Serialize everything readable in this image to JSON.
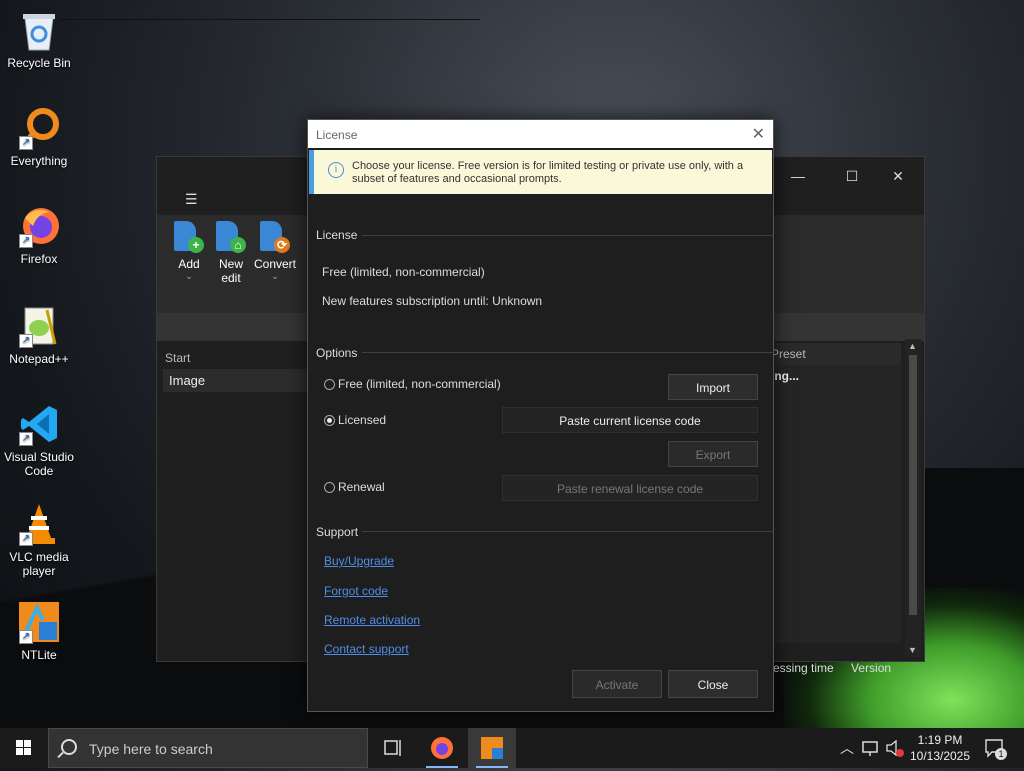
{
  "desktop": {
    "icons": [
      {
        "label": "Recycle Bin"
      },
      {
        "label": "Everything"
      },
      {
        "label": "Firefox"
      },
      {
        "label": "Notepad++"
      },
      {
        "label": "Visual Studio Code"
      },
      {
        "label": "VLC media player"
      },
      {
        "label": "NTLite"
      }
    ]
  },
  "app": {
    "toolbar": {
      "add": "Add",
      "new_edit": "New edit",
      "convert": "Convert"
    },
    "left_header": "Start",
    "left_row": "Image",
    "right_header": "Preset",
    "right_cell": "ing...",
    "status": {
      "processing_time": "cessing time",
      "version": "Version"
    }
  },
  "dialog": {
    "title": "License",
    "info": "Choose your license. Free version is for limited testing or private use only, with a subset of features and occasional prompts.",
    "license_section": "License",
    "license_type": "Free (limited, non-commercial)",
    "subscription": "New features subscription until: Unknown",
    "options_section": "Options",
    "opt_free": "Free (limited, non-commercial)",
    "opt_licensed": "Licensed",
    "opt_renewal": "Renewal",
    "import_btn": "Import",
    "paste_current_btn": "Paste current license code",
    "export_btn": "Export",
    "paste_renewal_btn": "Paste renewal license code",
    "support_section": "Support",
    "links": {
      "buy": "Buy/Upgrade",
      "forgot": "Forgot code",
      "remote": "Remote activation",
      "contact": "Contact support"
    },
    "activate_btn": "Activate",
    "close_btn": "Close",
    "selected_option": "Licensed"
  },
  "taskbar": {
    "search_placeholder": "Type here to search",
    "time": "1:19 PM",
    "date": "10/13/2025",
    "notification_count": "1"
  },
  "colors": {
    "accent_link": "#4f8ee8",
    "info_bg": "#fbf7d9",
    "info_border": "#4a9de0"
  }
}
